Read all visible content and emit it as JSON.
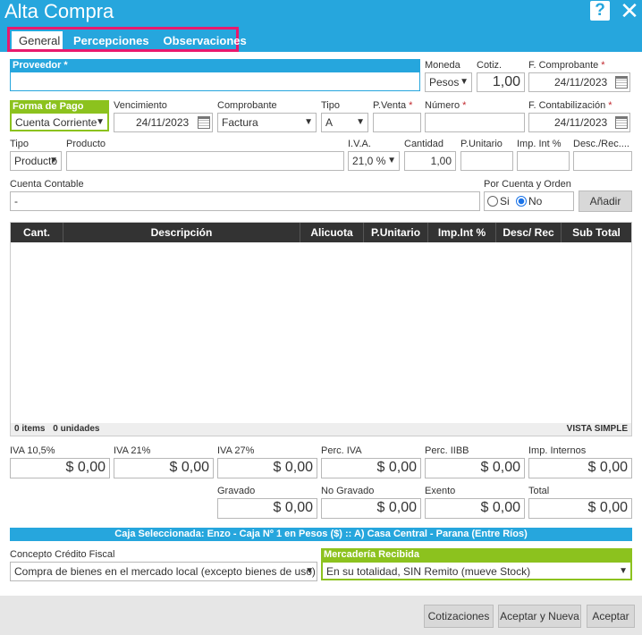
{
  "window": {
    "title": "Alta Compra"
  },
  "tabs": [
    "General",
    "Percepciones",
    "Observaciones"
  ],
  "proveedor": {
    "label": "Proveedor",
    "value": ""
  },
  "moneda": {
    "label": "Moneda",
    "value": "Pesos"
  },
  "cotiz": {
    "label": "Cotiz.",
    "value": "1,00"
  },
  "fecha_comprobante": {
    "label": "F. Comprobante",
    "value": "24/11/2023"
  },
  "forma_pago": {
    "label": "Forma de Pago",
    "value": "Cuenta Corriente"
  },
  "vencimiento": {
    "label": "Vencimiento",
    "value": "24/11/2023"
  },
  "comprobante": {
    "label": "Comprobante",
    "value": "Factura"
  },
  "tipo_comprobante": {
    "label": "Tipo",
    "value": "A"
  },
  "pventa": {
    "label": "P.Venta",
    "value": ""
  },
  "numero": {
    "label": "Número",
    "value": ""
  },
  "fecha_contabilizacion": {
    "label": "F. Contabilización",
    "value": "24/11/2023"
  },
  "item": {
    "tipo_label": "Tipo",
    "tipo_value": "Producto",
    "producto_label": "Producto",
    "producto_value": "",
    "iva_label": "I.V.A.",
    "iva_value": "21,0 %",
    "cantidad_label": "Cantidad",
    "cantidad_value": "1,00",
    "punitario_label": "P.Unitario",
    "punitario_value": "",
    "impint_label": "Imp. Int %",
    "impint_value": "",
    "desc_label": "Desc./Rec....",
    "desc_value": ""
  },
  "cuenta_contable": {
    "label": "Cuenta Contable",
    "value": "-"
  },
  "por_cuenta_orden": {
    "label": "Por Cuenta y Orden",
    "options": [
      "Si",
      "No"
    ],
    "selected": "No"
  },
  "add_button": "Añadir",
  "grid": {
    "columns": [
      "Cant.",
      "Descripción",
      "Alicuota",
      "P.Unitario",
      "Imp.Int %",
      "Desc/ Rec",
      "Sub Total"
    ],
    "rows": [],
    "footer_items": "0 items",
    "footer_units": "0 unidades",
    "footer_view": "VISTA SIMPLE"
  },
  "totals_row1": [
    {
      "label": "IVA 10,5%",
      "value": "$ 0,00"
    },
    {
      "label": "IVA 21%",
      "value": "$ 0,00"
    },
    {
      "label": "IVA 27%",
      "value": "$ 0,00"
    },
    {
      "label": "Perc. IVA",
      "value": "$ 0,00"
    },
    {
      "label": "Perc. IIBB",
      "value": "$ 0,00"
    },
    {
      "label": "Imp. Internos",
      "value": "$ 0,00"
    }
  ],
  "totals_row2": [
    {
      "label": "Gravado",
      "value": "$ 0,00"
    },
    {
      "label": "No Gravado",
      "value": "$ 0,00"
    },
    {
      "label": "Exento",
      "value": "$ 0,00"
    },
    {
      "label": "Total",
      "value": "$ 0,00"
    }
  ],
  "caja_text": "Caja Seleccionada: Enzo - Caja Nº 1 en Pesos ($) :: A) Casa Central - Parana (Entre Ríos)",
  "concepto": {
    "label": "Concepto Crédito Fiscal",
    "value": "Compra de bienes en el mercado local (excepto bienes de uso)"
  },
  "mercaderia": {
    "label": "Mercadería Recibida",
    "value": "En su totalidad, SIN Remito (mueve Stock)"
  },
  "footer_buttons": [
    "Cotizaciones",
    "Aceptar y Nueva",
    "Aceptar"
  ],
  "colors": {
    "primary": "#26a6dd",
    "accent": "#8cc21e",
    "highlight": "#e8196d",
    "required": "#c1272d"
  }
}
